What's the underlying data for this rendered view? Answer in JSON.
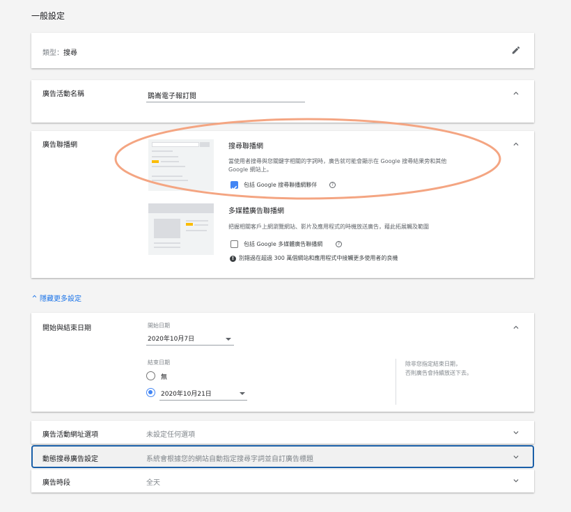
{
  "page": {
    "section_title": "一般設定",
    "toggle_more": "隱藏更多設定"
  },
  "type_card": {
    "label": "類型：",
    "value": "搜尋"
  },
  "campaign_name": {
    "label": "廣告活動名稱",
    "value": "鵲崙電子報訂閱"
  },
  "networks": {
    "label": "廣告聯播網",
    "search": {
      "title": "搜尋聯播網",
      "desc_line1": "當使用者搜尋與您關鍵字相關的字詞時，廣告就可能會顯示在 Google 搜尋結果旁和其他",
      "desc_line2": "Google 網站上。",
      "checkbox_label": "包括 Google 搜尋聯播網夥伴",
      "checked": true
    },
    "display": {
      "title": "多媒體廣告聯播網",
      "desc": "把握相關客戶上網瀏覽網站、影片及應用程式的時機放送廣告，藉此拓展觸及範圍",
      "checkbox_label": "包括 Google 多媒體廣告聯播網",
      "checked": false,
      "info": "別錯過在超過 300 萬個網站和應用程式中接觸更多使用者的良機"
    },
    "highlight_color": "#f4a582"
  },
  "dates": {
    "label": "開始與結束日期",
    "start_label": "開始日期",
    "start_value": "2020年10月7日",
    "end_label": "結束日期",
    "option_none": "無",
    "option_date": "2020年10月21日",
    "selected": "date",
    "note_line1": "除非您指定結束日期，",
    "note_line2": "否則廣告會持續放送下去。"
  },
  "rows": [
    {
      "label": "廣告活動網址選項",
      "value": "未設定任何選項"
    },
    {
      "label": "動態搜尋廣告設定",
      "value": "系統會根據您的網站自動指定搜尋字詞並自訂廣告標題"
    },
    {
      "label": "廣告時段",
      "value": "全天"
    }
  ],
  "colors": {
    "accent": "#4285f4",
    "link": "#1a73e8",
    "focus_border": "#1a5fa8"
  }
}
